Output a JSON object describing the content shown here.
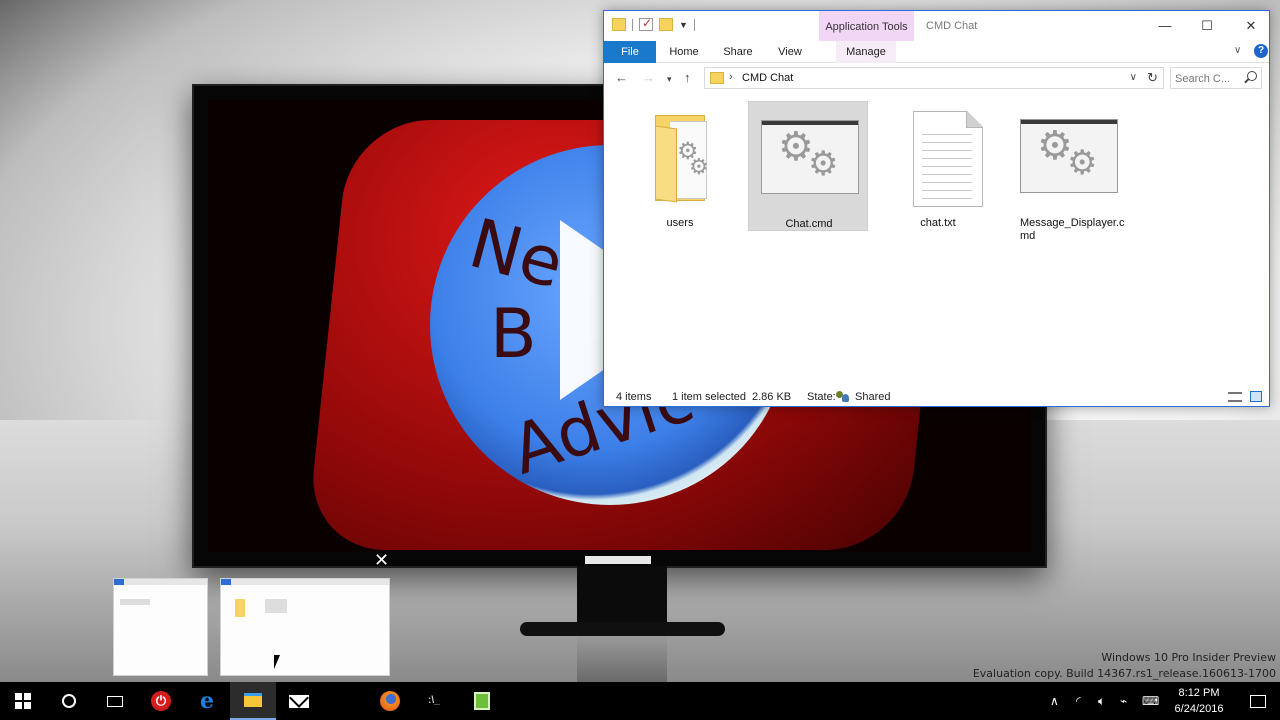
{
  "window": {
    "title": "CMD Chat",
    "contextual_tab": "Application Tools",
    "controls": {
      "minimize": "—",
      "maximize": "☐",
      "close": "✕"
    }
  },
  "ribbon": {
    "tabs": [
      {
        "label": "File",
        "active": true
      },
      {
        "label": "Home"
      },
      {
        "label": "Share"
      },
      {
        "label": "View"
      },
      {
        "label": "Manage"
      }
    ]
  },
  "navigation": {
    "address_path": "CMD Chat",
    "search_placeholder": "Search C..."
  },
  "files": [
    {
      "name": "users",
      "type": "folder"
    },
    {
      "name": "Chat.cmd",
      "type": "cmd",
      "selected": true
    },
    {
      "name": "chat.txt",
      "type": "txt"
    },
    {
      "name": "Message_Displayer.cmd",
      "label_line1": "Message_Displayer.c",
      "label_line2": "md",
      "type": "cmd"
    }
  ],
  "status": {
    "item_count": "4 items",
    "selection": "1 item selected",
    "size": "2.86 KB",
    "state_label": "State:",
    "state_value": "Shared"
  },
  "watermark": {
    "line1": "Windows 10 Pro Insider Preview",
    "line2": "Evaluation copy. Build 14367.rs1_release.160613-1700"
  },
  "taskbar": {
    "time": "8:12 PM",
    "date": "6/24/2016",
    "apps": [
      "start-icon",
      "cortana-icon",
      "task-view-icon",
      "power-icon",
      "edge-icon",
      "file-explorer-icon",
      "mail-icon",
      "firefox-icon",
      "cmd-icon",
      "notepad-icon"
    ]
  },
  "colors": {
    "accent": "#1979ca",
    "contextual_tab": "#f1d6f6",
    "selection": "#d9d9d9"
  }
}
